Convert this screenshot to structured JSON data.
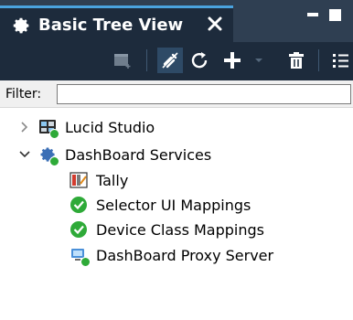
{
  "tab": {
    "title": "Basic Tree View",
    "close_glyph": "×",
    "icon": "gear-icon"
  },
  "window_controls": {
    "minimize": "minimize",
    "maximize": "maximize"
  },
  "toolbar": {
    "buttons": [
      {
        "name": "new-node-icon",
        "enabled": false
      },
      {
        "name": "disconnect-icon",
        "selected": true
      },
      {
        "name": "refresh-icon"
      },
      {
        "name": "add-icon"
      },
      {
        "name": "delete-icon"
      },
      {
        "name": "list-view-icon"
      }
    ]
  },
  "filter": {
    "label": "Filter:",
    "value": ""
  },
  "tree": {
    "nodes": [
      {
        "label": "Lucid Studio",
        "level": 0,
        "expanded": false,
        "icon": "lucid-studio-icon"
      },
      {
        "label": "DashBoard Services",
        "level": 0,
        "expanded": true,
        "icon": "services-gear-icon"
      },
      {
        "label": "Tally",
        "level": 1,
        "icon": "tally-icon"
      },
      {
        "label": "Selector UI Mappings",
        "level": 1,
        "icon": "green-check-icon"
      },
      {
        "label": "Device Class Mappings",
        "level": 1,
        "icon": "green-check-icon"
      },
      {
        "label": "DashBoard Proxy Server",
        "level": 1,
        "icon": "proxy-server-icon"
      }
    ]
  },
  "colors": {
    "titlebar": "#2f3f52",
    "tab_active": "#1d2b3c",
    "tab_accent": "#4aa3df",
    "status_ok": "#2eaa38"
  }
}
